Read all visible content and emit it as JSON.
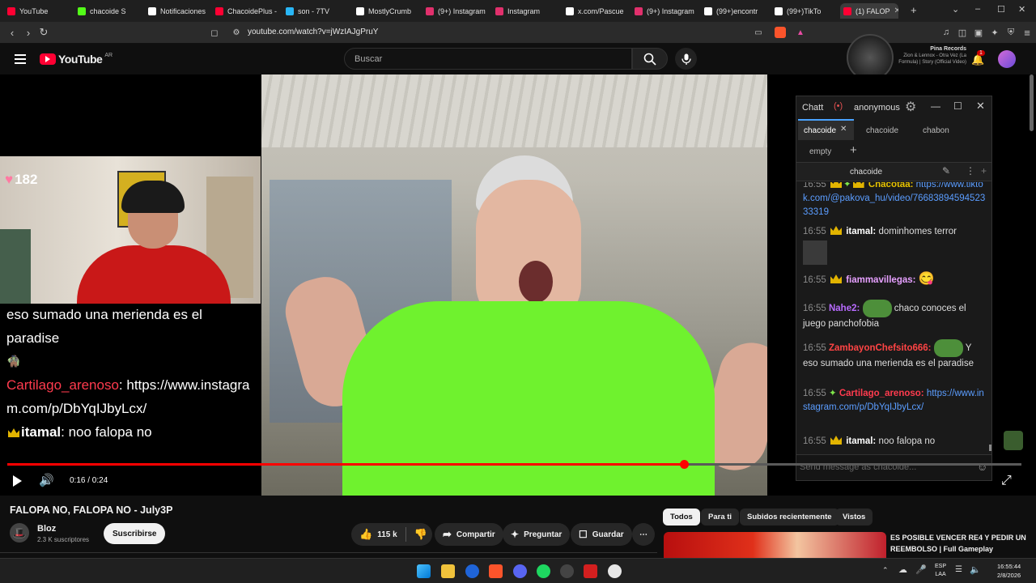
{
  "browser": {
    "tabs": [
      {
        "title": "YouTube",
        "icon": "youtube-icon",
        "color": "#ff0033"
      },
      {
        "title": "chacoide S",
        "icon": "kick-icon",
        "color": "#53fc18"
      },
      {
        "title": "Notificaciones",
        "icon": "x-icon",
        "color": "#ffffff"
      },
      {
        "title": "ChacoidePlus -",
        "icon": "youtube-icon",
        "color": "#ff0033"
      },
      {
        "title": "son - 7TV",
        "icon": "7tv-icon",
        "color": "#29b6f6"
      },
      {
        "title": "MostlyCrumb",
        "icon": "x-icon",
        "color": "#ffffff"
      },
      {
        "title": "(9+) Instagram",
        "icon": "instagram-icon",
        "color": "#e1306c"
      },
      {
        "title": "Instagram",
        "icon": "instagram-icon",
        "color": "#e1306c"
      },
      {
        "title": "x.com/Pascue",
        "icon": "x-icon",
        "color": "#ffffff"
      },
      {
        "title": "(9+) Instagram",
        "icon": "instagram-icon",
        "color": "#e1306c"
      },
      {
        "title": "(99+)encontr",
        "icon": "tiktok-icon",
        "color": "#ffffff"
      },
      {
        "title": "(99+)TikTo",
        "icon": "tiktok-icon",
        "color": "#ffffff"
      },
      {
        "title": "(1) FALOP",
        "icon": "youtube-icon",
        "color": "#ff0033",
        "active": true
      }
    ],
    "url": "youtube.com/watch?v=jWzIAJgPruY"
  },
  "youtube": {
    "logo": "YouTube",
    "region": "AR",
    "search_placeholder": "Buscar",
    "mini_player": {
      "artist": "Pina Records",
      "song": "Zion & Lennox - Otra Vez (La Formula) | Story (Official Video)"
    },
    "notification_count": "1"
  },
  "webcam_overlay": {
    "hearts": "182",
    "chat_lines": [
      {
        "text": "eso sumado una merienda es el"
      },
      {
        "text": "paradise"
      },
      {
        "text": "🧌"
      },
      {
        "user": "Cartilago_arenoso",
        "user_color": "#ff3b4e",
        "text": ": https://www.instagram.com/p/DbYqIJbyLcx/"
      },
      {
        "user": "itamal",
        "user_color": "#ffffff",
        "text": ": noo falopa no",
        "badge": "crown"
      }
    ]
  },
  "chatt": {
    "title": "Chatt",
    "user": "anonymous",
    "tabs": [
      "chacoide",
      "chacoide",
      "chabon",
      "empty"
    ],
    "channel": "chacoide",
    "messages": [
      {
        "time": "16:55",
        "user": "Chacotaa:",
        "user_color": "#e8c300",
        "text": "https://www.tiktok.com/@pakova_hu/video/7668389459452333319",
        "is_link": true
      },
      {
        "time": "16:55",
        "user": "itamal:",
        "user_color": "#ffffff",
        "text": "dominhomes terror"
      },
      {
        "time": "16:55",
        "user": "fiammavillegas:",
        "user_color": "#e6a0ff",
        "text": "😋"
      },
      {
        "time": "16:55",
        "user": "Nahe2:",
        "user_color": "#b86bff",
        "text": "chaco conoces el juego panchofobia"
      },
      {
        "time": "16:55",
        "user": "ZambayonChefsito666:",
        "user_color": "#ff4444",
        "text": "Y eso sumado una merienda es el paradise"
      },
      {
        "time": "16:55",
        "user": "Cartilago_arenoso:",
        "user_color": "#ff3b4e",
        "text": "https://www.instagram.com/p/DbYqIJbyLcx/",
        "is_link": true
      },
      {
        "time": "16:55",
        "user": "itamal:",
        "user_color": "#ffffff",
        "text": "noo falopa no"
      }
    ],
    "input_placeholder": "Send message as chacoide..."
  },
  "player": {
    "time": "0:16 / 0:24",
    "progress": 0.667
  },
  "video": {
    "title": "FALOPA NO, FALOPA NO - July3P",
    "channel": "Bloz",
    "subscribers": "2.3 K suscriptores",
    "subscribe_label": "Suscribirse",
    "likes": "115 k",
    "share_label": "Compartir",
    "ask_label": "Preguntar",
    "save_label": "Guardar"
  },
  "filters": [
    "Todos",
    "Para ti",
    "Subidos recientemente",
    "Vistos"
  ],
  "recommendation": {
    "title": "ES POSIBLE VENCER RE4 Y PEDIR UN REEMBOLSO | Full Gameplay"
  },
  "taskbar": {
    "lang": "ESP",
    "layout": "LAA",
    "time": "16:55:44",
    "date": "2/8/2026"
  }
}
